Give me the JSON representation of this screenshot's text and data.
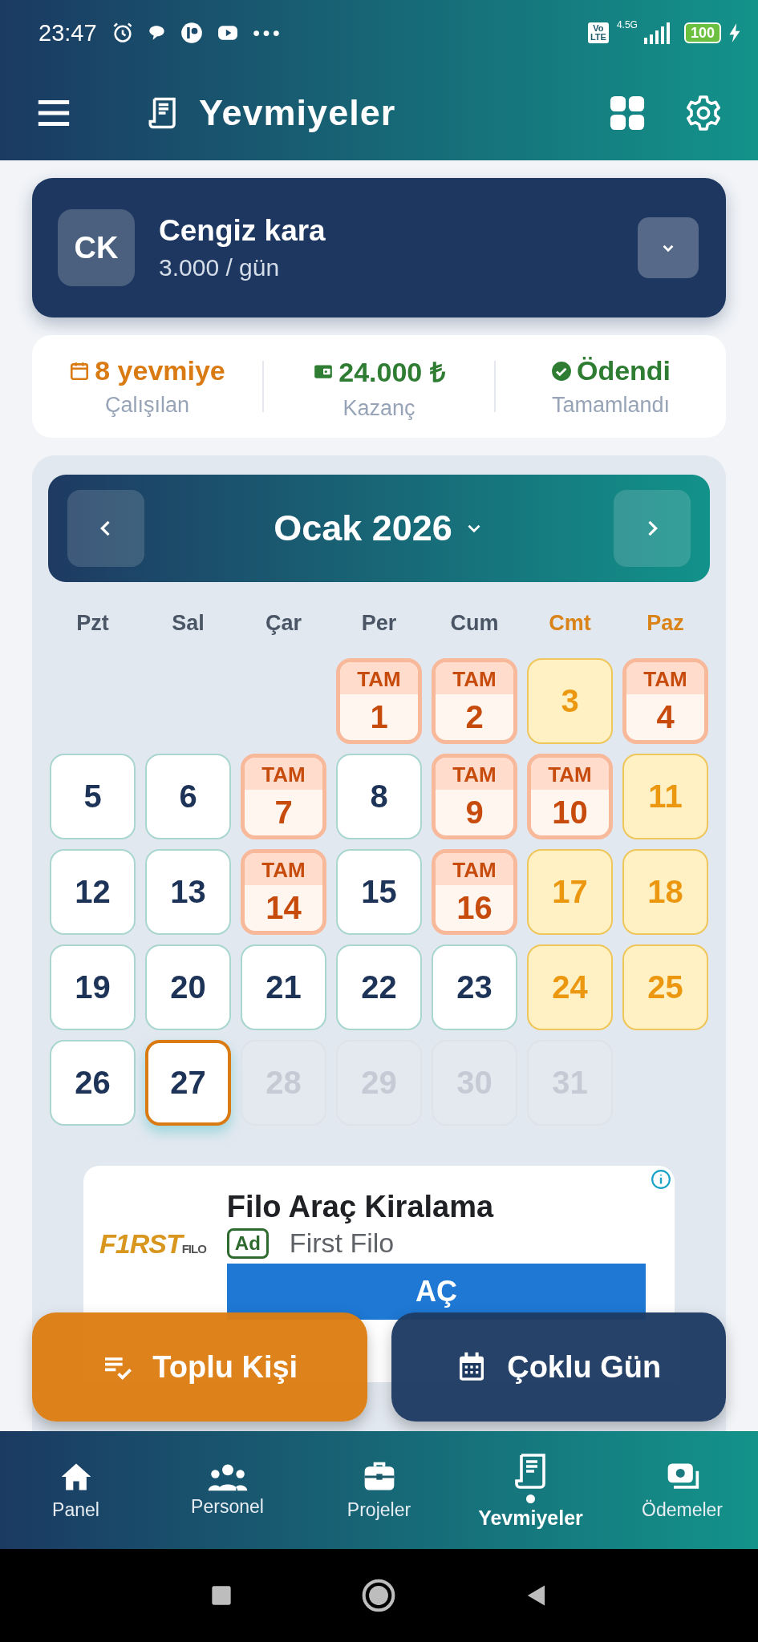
{
  "status_bar": {
    "time": "23:47",
    "volte": [
      "Vo",
      "LTE"
    ],
    "network": "4.5G",
    "battery": "100"
  },
  "header": {
    "title": "Yevmiyeler"
  },
  "worker": {
    "initials": "CK",
    "name": "Cengiz kara",
    "rate": "3.000 / gün"
  },
  "summary": [
    {
      "kind": "days",
      "value": "8 yevmiye",
      "label": "Çalışılan"
    },
    {
      "kind": "money",
      "value": "24.000 ₺",
      "label": "Kazanç"
    },
    {
      "kind": "paid",
      "value": "Ödendi",
      "label": "Tamamlandı"
    }
  ],
  "calendar": {
    "month": "Ocak 2026",
    "weekdays": [
      {
        "label": "Pzt",
        "weekend": false
      },
      {
        "label": "Sal",
        "weekend": false
      },
      {
        "label": "Çar",
        "weekend": false
      },
      {
        "label": "Per",
        "weekend": false
      },
      {
        "label": "Cum",
        "weekend": false
      },
      {
        "label": "Cmt",
        "weekend": true
      },
      {
        "label": "Paz",
        "weekend": true
      }
    ],
    "weeks": [
      [
        {
          "day": "1",
          "kind": "worked",
          "tag": "TAM"
        },
        {
          "day": "2",
          "kind": "worked",
          "tag": "TAM"
        },
        {
          "day": "3",
          "kind": "weekend"
        },
        {
          "day": "4",
          "kind": "worked",
          "tag": "TAM"
        }
      ],
      [
        {
          "day": "5",
          "kind": "normal"
        },
        {
          "day": "6",
          "kind": "normal"
        },
        {
          "day": "7",
          "kind": "worked",
          "tag": "TAM"
        },
        {
          "day": "8",
          "kind": "normal"
        },
        {
          "day": "9",
          "kind": "worked",
          "tag": "TAM"
        },
        {
          "day": "10",
          "kind": "worked",
          "tag": "TAM"
        },
        {
          "day": "11",
          "kind": "weekend"
        }
      ],
      [
        {
          "day": "12",
          "kind": "normal"
        },
        {
          "day": "13",
          "kind": "normal"
        },
        {
          "day": "14",
          "kind": "worked",
          "tag": "TAM"
        },
        {
          "day": "15",
          "kind": "normal"
        },
        {
          "day": "16",
          "kind": "worked",
          "tag": "TAM"
        },
        {
          "day": "17",
          "kind": "weekend"
        },
        {
          "day": "18",
          "kind": "weekend"
        }
      ],
      [
        {
          "day": "19",
          "kind": "normal"
        },
        {
          "day": "20",
          "kind": "normal"
        },
        {
          "day": "21",
          "kind": "normal"
        },
        {
          "day": "22",
          "kind": "normal"
        },
        {
          "day": "23",
          "kind": "normal"
        },
        {
          "day": "24",
          "kind": "weekend"
        },
        {
          "day": "25",
          "kind": "weekend"
        }
      ],
      [
        {
          "day": "26",
          "kind": "normal"
        },
        {
          "day": "27",
          "kind": "today"
        },
        {
          "day": "28",
          "kind": "future"
        },
        {
          "day": "29",
          "kind": "future"
        },
        {
          "day": "30",
          "kind": "future"
        },
        {
          "day": "31",
          "kind": "future"
        }
      ]
    ]
  },
  "ad": {
    "logo": "F1RST",
    "logo_suffix": "FILO",
    "title": "Filo Araç Kiralama",
    "badge": "Ad",
    "advertiser": "First Filo",
    "button": "AÇ"
  },
  "actions": [
    {
      "kind": "people",
      "label": "Toplu Kişi"
    },
    {
      "kind": "days",
      "label": "Çoklu Gün"
    }
  ],
  "nav": [
    {
      "kind": "home",
      "label": "Panel",
      "selected": false
    },
    {
      "kind": "people",
      "label": "Personel",
      "selected": false
    },
    {
      "kind": "projects",
      "label": "Projeler",
      "selected": false
    },
    {
      "kind": "receipt",
      "label": "Yevmiyeler",
      "selected": true
    },
    {
      "kind": "payments",
      "label": "Ödemeler",
      "selected": false
    }
  ]
}
